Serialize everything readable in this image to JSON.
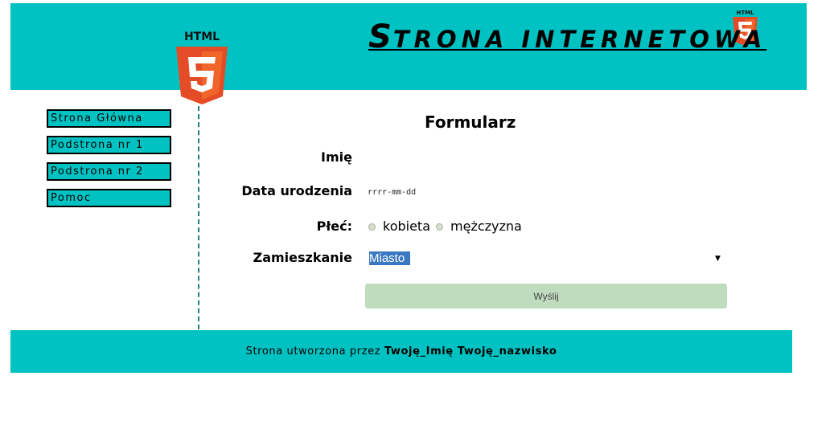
{
  "header": {
    "title_initial": "S",
    "title_rest": "TRONA INTERNETOWA",
    "logo_text": "HTML",
    "logo_number": "5",
    "background": "#00c2c2"
  },
  "nav": {
    "items": [
      {
        "label": "Strona Główna"
      },
      {
        "label": "Podstrona nr 1"
      },
      {
        "label": "Podstrona nr 2"
      },
      {
        "label": "Pomoc"
      }
    ]
  },
  "form": {
    "title": "Formularz",
    "name_label": "Imię",
    "birthdate_label": "Data urodzenia",
    "birthdate_placeholder": "rrrr-mm-dd",
    "gender_label": "Płeć:",
    "gender_options": [
      "kobieta",
      "mężczyzna"
    ],
    "residence_label": "Zamieszkanie",
    "residence_selected": "Miasto",
    "submit_label": "Wyślij",
    "submit_color": "#c0dcbe"
  },
  "footer": {
    "prefix": "Strona utworzona przez ",
    "author": "Twoję_Imię Twoję_nazwisko"
  }
}
